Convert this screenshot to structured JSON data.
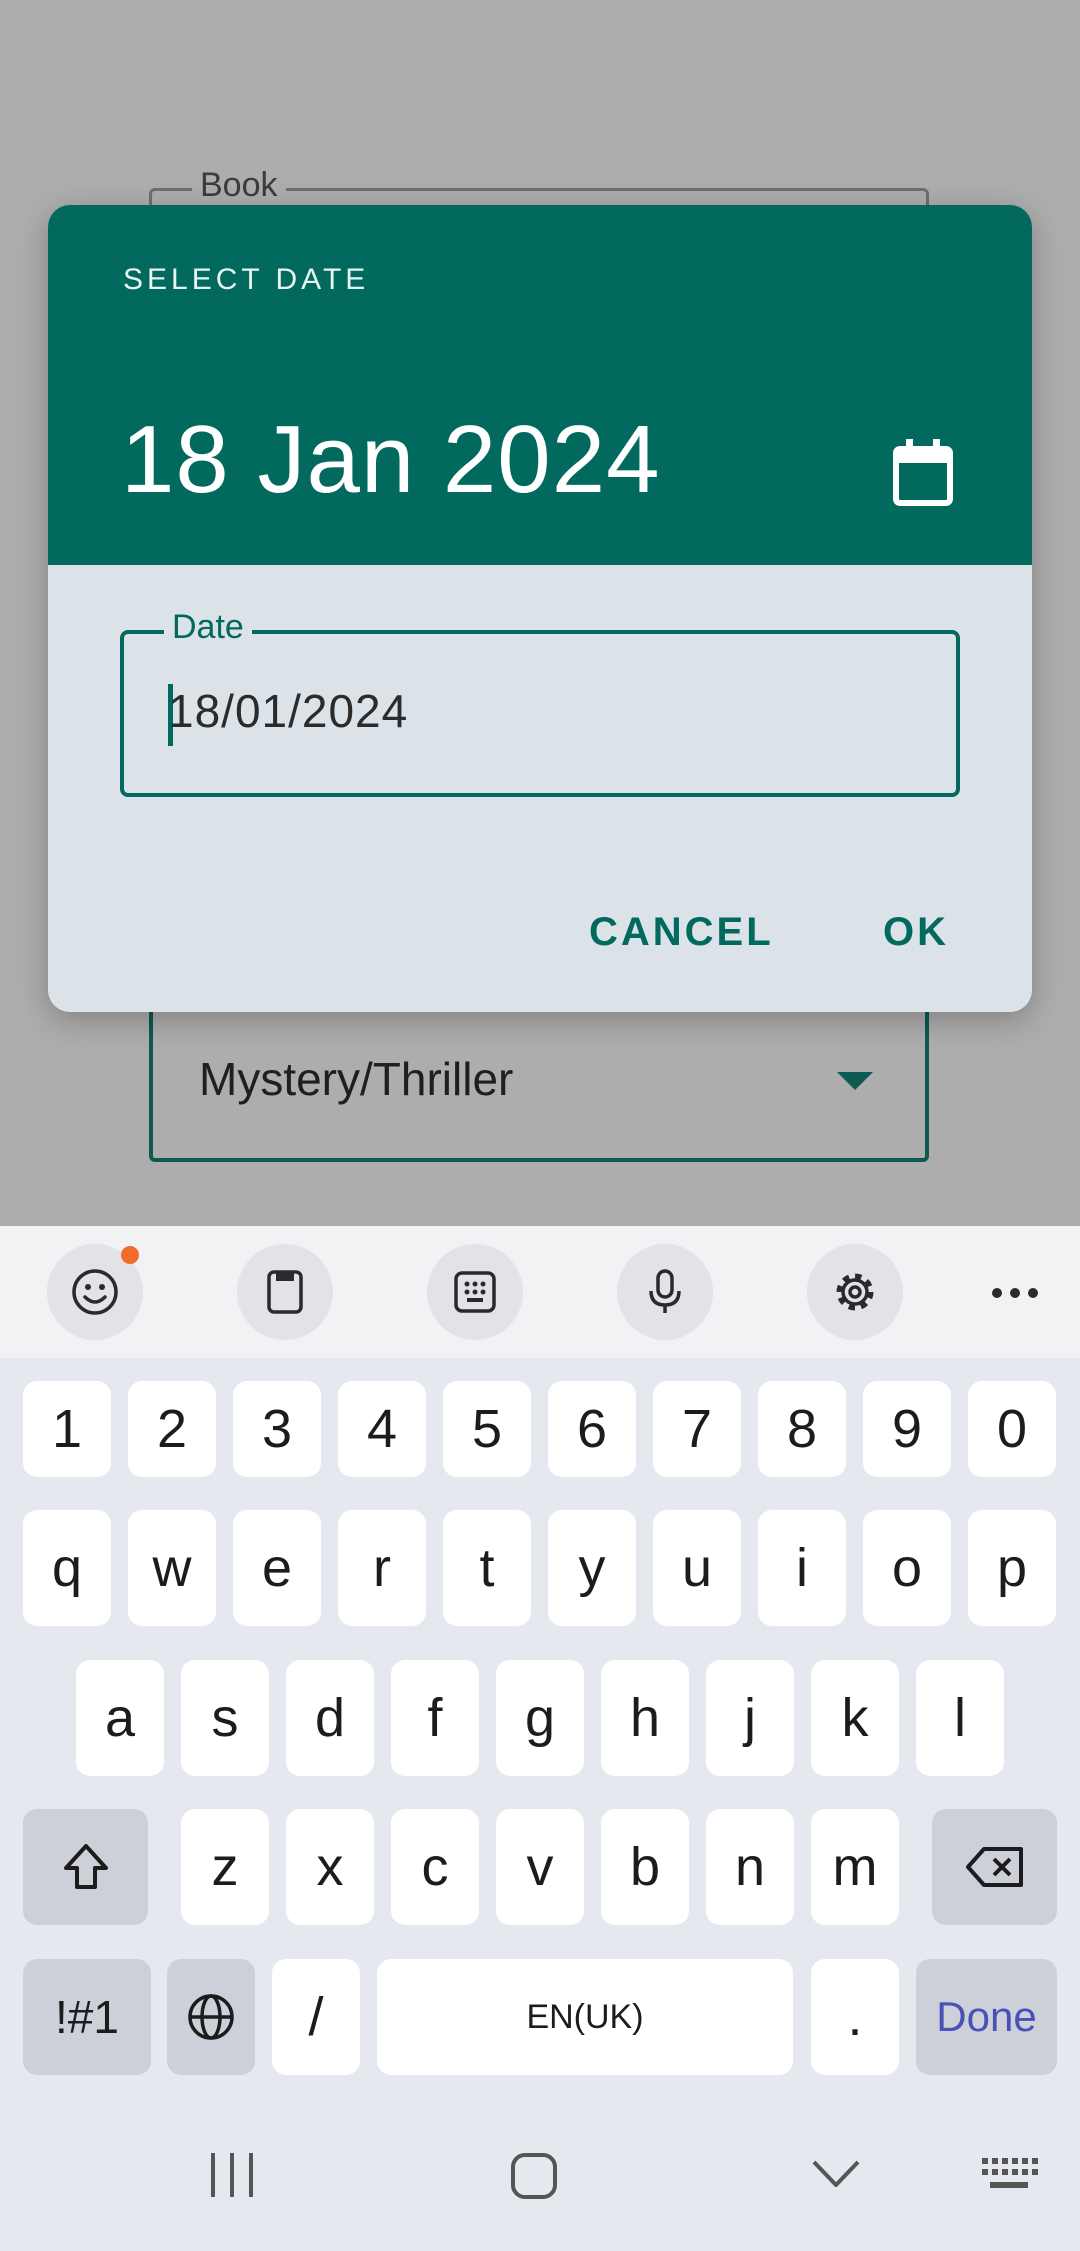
{
  "background": {
    "book_label": "Book",
    "genre_value": "Mystery/Thriller"
  },
  "dialog": {
    "title": "SELECT DATE",
    "selected_date": "18 Jan 2024",
    "field_label": "Date",
    "field_value": "18/01/2024",
    "cancel_label": "CANCEL",
    "ok_label": "OK",
    "colors": {
      "header": "#02695e",
      "body": "#dbe3e9"
    }
  },
  "keyboard": {
    "toolbar_icons": [
      "emoji-icon",
      "clipboard-icon",
      "keypad-icon",
      "microphone-icon",
      "settings-icon",
      "more-icon"
    ],
    "row_numbers": [
      "1",
      "2",
      "3",
      "4",
      "5",
      "6",
      "7",
      "8",
      "9",
      "0"
    ],
    "row_top": [
      "q",
      "w",
      "e",
      "r",
      "t",
      "y",
      "u",
      "i",
      "o",
      "p"
    ],
    "row_middle": [
      "a",
      "s",
      "d",
      "f",
      "g",
      "h",
      "j",
      "k",
      "l"
    ],
    "row_bottom": [
      "z",
      "x",
      "c",
      "v",
      "b",
      "n",
      "m"
    ],
    "symbols_label": "!#1",
    "slash_label": "/",
    "space_label": "EN(UK)",
    "period_label": ".",
    "done_label": "Done"
  }
}
